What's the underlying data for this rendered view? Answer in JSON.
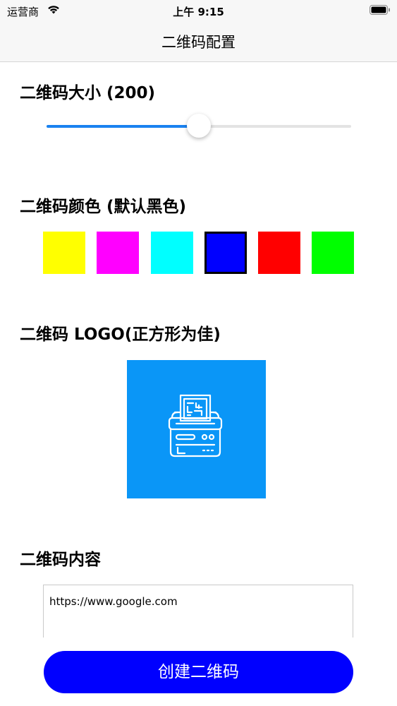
{
  "status_bar": {
    "carrier": "运营商",
    "time": "上午 9:15",
    "icons": [
      "wifi-icon",
      "battery-icon"
    ]
  },
  "nav": {
    "title": "二维码配置"
  },
  "size_section": {
    "title": "二维码大小 (200)",
    "slider_fraction": 0.5
  },
  "color_section": {
    "title": "二维码颜色 (默认黑色)",
    "swatches": [
      "#ffff00",
      "#ff00ff",
      "#00ffff",
      "#0000ff",
      "#ff0000",
      "#00ff00"
    ],
    "selected_index": 3
  },
  "logo_section": {
    "title": "二维码 LOGO(正方形为佳)",
    "logo_icon": "printer-icon",
    "logo_background": "#0a96f7"
  },
  "content_section": {
    "title": "二维码内容",
    "value": "https://www.google.com"
  },
  "create_button": {
    "label": "创建二维码",
    "color": "#0000ff"
  }
}
